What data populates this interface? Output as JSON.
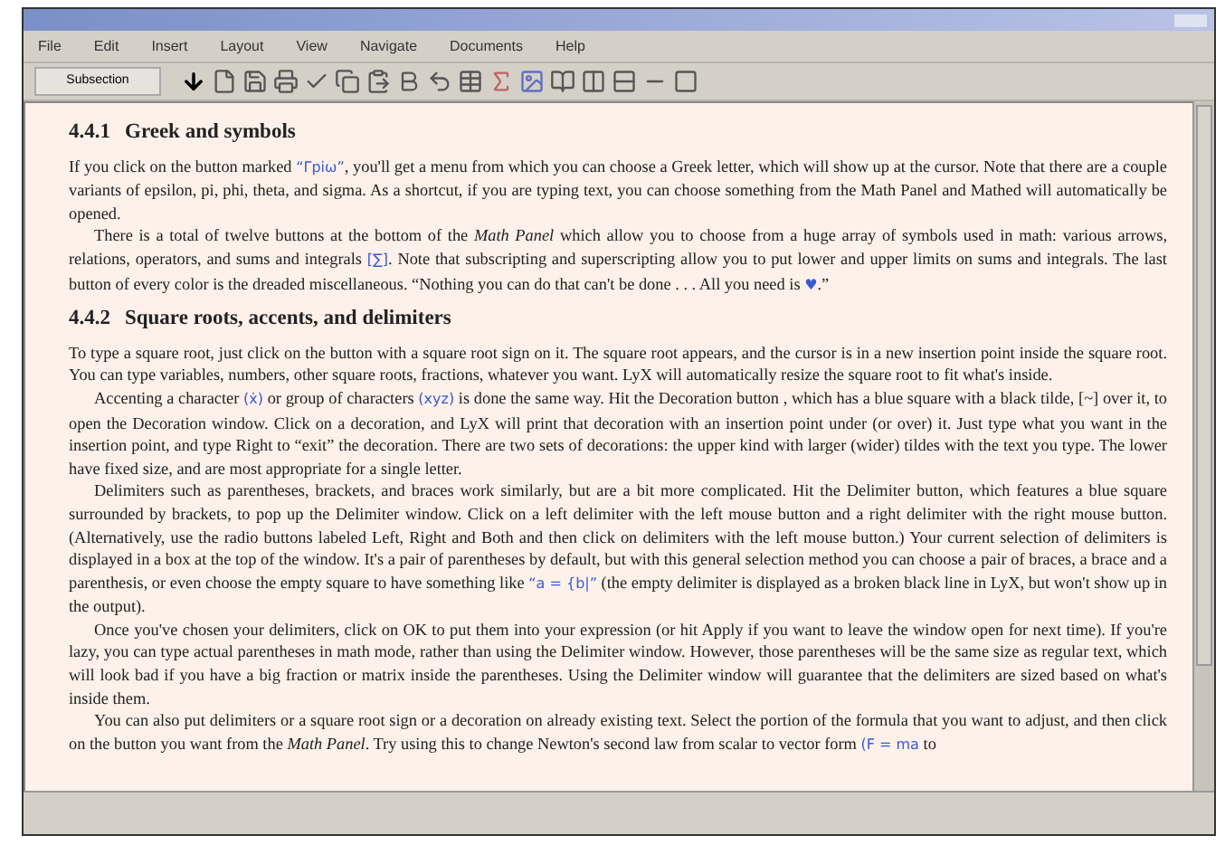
{
  "menu": [
    "File",
    "Edit",
    "Insert",
    "Layout",
    "View",
    "Navigate",
    "Documents",
    "Help"
  ],
  "toolbar": {
    "layout_combo": "Subsection"
  },
  "sections": [
    {
      "number": "4.4.1",
      "title": "Greek and symbols",
      "paragraphs": [
        [
          {
            "kind": "text",
            "text": "If you click on the button marked "
          },
          {
            "kind": "math",
            "text": "“Γpiω”"
          },
          {
            "kind": "text",
            "text": ", you'll get a menu from which you can choose a Greek letter, which will show up at the cursor. Note that there are a couple variants of epsilon, pi, phi, theta, and sigma. As a shortcut, if you are typing text, you can choose something from the Math Panel and Mathed will automatically be opened."
          }
        ],
        [
          {
            "kind": "text",
            "text": "There is a total of twelve buttons at the bottom of the *Math Panel* which allow you to choose from a huge array of symbols used in math: various arrows, relations, operators, and sums and integrals "
          },
          {
            "kind": "math",
            "text": "[∑]"
          },
          {
            "kind": "text",
            "text": ". Note that subscripting and superscripting allow you to put lower and upper limits on sums and integrals. The last button of every color is the dreaded miscellaneous. “Nothing you can do that can't be done . . . All you need is "
          },
          {
            "kind": "math",
            "text": "♥"
          },
          {
            "kind": "text",
            "text": ".”"
          }
        ]
      ]
    },
    {
      "number": "4.4.2",
      "title": "Square roots, accents, and delimiters",
      "paragraphs": [
        [
          {
            "kind": "text",
            "text": "To type a square root, just click on the button with a square root sign on it. The square root appears, and the cursor is in a new insertion point inside the square root. You can type variables, numbers, other square roots, fractions, whatever you want. LyX will automatically resize the square root to fit what's inside."
          }
        ],
        [
          {
            "kind": "text",
            "text": "Accenting a character "
          },
          {
            "kind": "math",
            "text": "(ẋ)"
          },
          {
            "kind": "text",
            "text": " or group of characters "
          },
          {
            "kind": "math",
            "text": "(xyz)"
          },
          {
            "kind": "text",
            "text": " is done the same way. Hit the Decoration button , which has a blue square with a black tilde, [~] over it, to open the Decoration window. Click on a decoration, and LyX will print that decoration with an insertion point under (or over) it. Just type what you want in the insertion point, and type Right to “exit” the decoration. There are two sets of decorations: the upper kind with larger (wider) tildes with the text you type. The lower have fixed size, and are most appropriate for a single letter."
          }
        ],
        [
          {
            "kind": "text",
            "text": "Delimiters such as parentheses, brackets, and braces work similarly, but are a bit more complicated. Hit the Delimiter button, which features a blue square surrounded by brackets, to pop up the Delimiter window. Click on a left delimiter with the left mouse button and a right delimiter with the right mouse button. (Alternatively, use the radio buttons labeled Left, Right and Both and then click on delimiters with the left mouse button.) Your current selection of delimiters is displayed in a box at the top of the window. It's a pair of parentheses by default, but with this general selection method you can choose a pair of braces, a brace and a parenthesis, or even choose the empty square to have something like "
          },
          {
            "kind": "math",
            "text": "“a = {b|”"
          },
          {
            "kind": "text",
            "text": " (the empty delimiter is displayed as a broken black line in LyX, but won't show up in the output)."
          }
        ],
        [
          {
            "kind": "text",
            "text": "Once you've chosen your delimiters, click on OK to put them into your expression (or hit Apply if you want to leave the window open for next time). If you're lazy, you can type actual parentheses in math mode, rather than using the Delimiter window. However, those parentheses will be the same size as regular text, which will look bad if you have a big fraction or matrix inside the parentheses. Using the Delimiter window will guarantee that the delimiters are sized based on what's inside them."
          }
        ],
        [
          {
            "kind": "text",
            "text": "You can also put delimiters or a square root sign or a decoration on already existing text. Select the portion of the formula that you want to adjust, and then click on the button you want from the *Math Panel*. Try using this to change Newton's second law from scalar to vector form "
          },
          {
            "kind": "math",
            "text": "(F = ma"
          },
          {
            "kind": "text",
            "text": " to"
          }
        ]
      ]
    }
  ]
}
